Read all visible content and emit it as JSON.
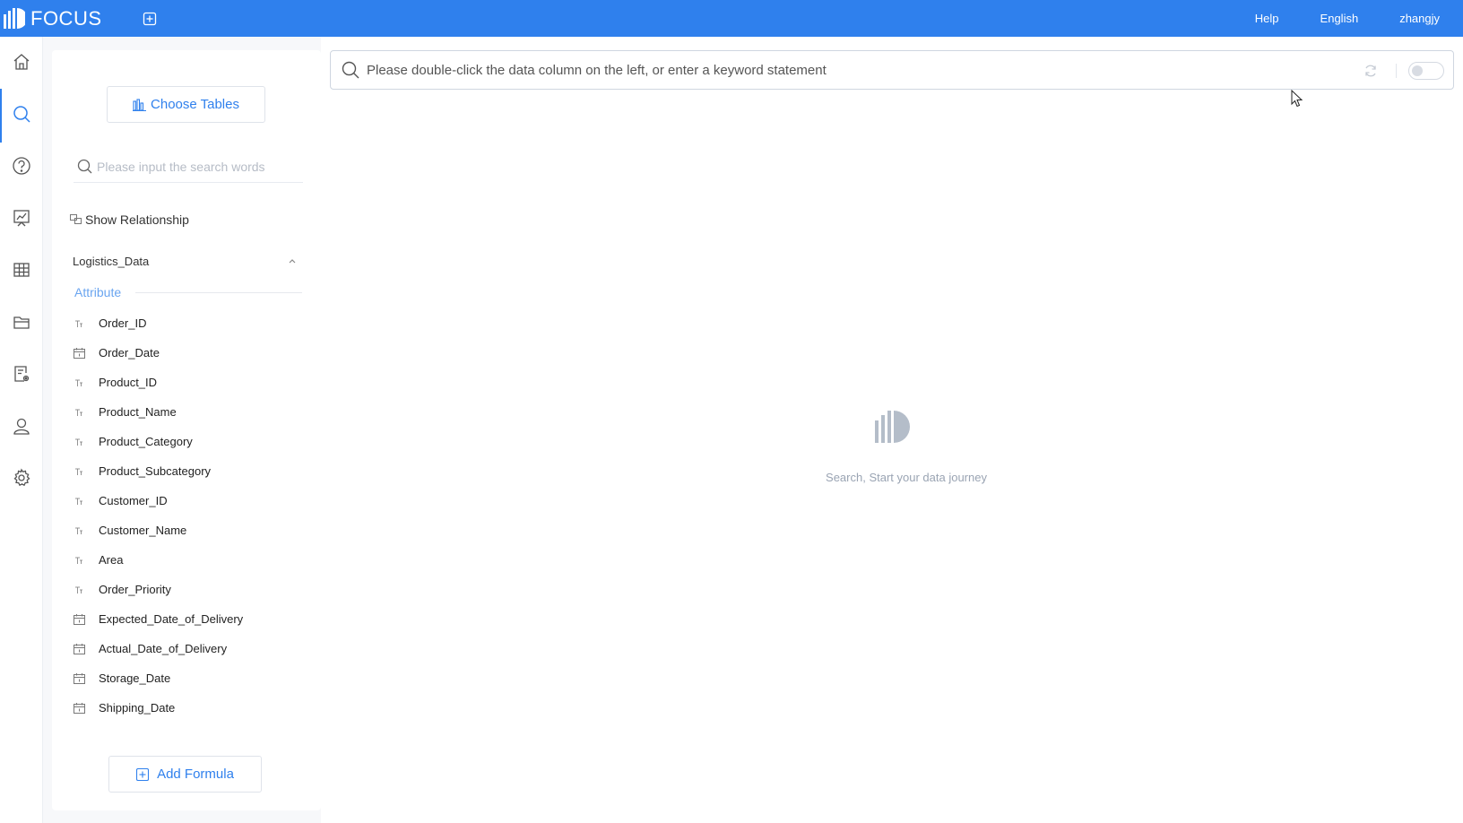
{
  "app": {
    "logo_text": "FOCUS"
  },
  "topbar": {
    "help": "Help",
    "language": "English",
    "user": "zhangjy"
  },
  "nav": [
    {
      "name": "home-icon"
    },
    {
      "name": "search-icon",
      "active": true
    },
    {
      "name": "help-circle-icon"
    },
    {
      "name": "chart-board-icon"
    },
    {
      "name": "table-grid-icon"
    },
    {
      "name": "folder-icon"
    },
    {
      "name": "report-settings-icon"
    },
    {
      "name": "user-icon"
    },
    {
      "name": "gear-icon"
    }
  ],
  "panel": {
    "choose_tables": "Choose Tables",
    "search_placeholder": "Please input the search words",
    "show_relationship": "Show Relationship",
    "table_name": "Logistics_Data",
    "section_label": "Attribute",
    "add_formula": "Add Formula",
    "fields": [
      {
        "label": "Order_ID",
        "type": "text"
      },
      {
        "label": "Order_Date",
        "type": "date"
      },
      {
        "label": "Product_ID",
        "type": "text"
      },
      {
        "label": "Product_Name",
        "type": "text"
      },
      {
        "label": "Product_Category",
        "type": "text"
      },
      {
        "label": "Product_Subcategory",
        "type": "text"
      },
      {
        "label": "Customer_ID",
        "type": "text"
      },
      {
        "label": "Customer_Name",
        "type": "text"
      },
      {
        "label": "Area",
        "type": "text"
      },
      {
        "label": "Order_Priority",
        "type": "text"
      },
      {
        "label": "Expected_Date_of_Delivery",
        "type": "date"
      },
      {
        "label": "Actual_Date_of_Delivery",
        "type": "date"
      },
      {
        "label": "Storage_Date",
        "type": "date"
      },
      {
        "label": "Shipping_Date",
        "type": "date"
      }
    ]
  },
  "main": {
    "query_placeholder": "Please double-click the data column on the left, or enter a keyword statement",
    "empty_text": "Search, Start your data journey"
  },
  "colors": {
    "brand": "#2f80ed",
    "accent_light": "#6aa5f0"
  }
}
